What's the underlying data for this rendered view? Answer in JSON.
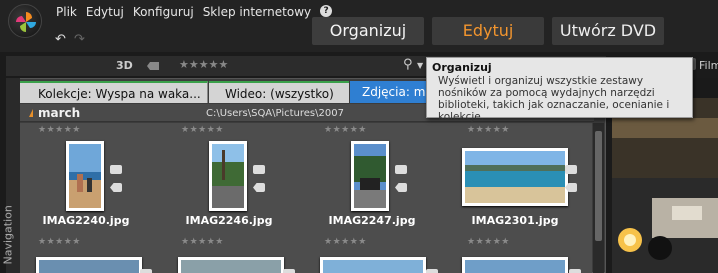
{
  "menu": {
    "file": "Plik",
    "edit": "Edytuj",
    "configure": "Konfiguruj",
    "store": "Sklep internetowy",
    "help": "?"
  },
  "modes": {
    "organize": "Organizuj",
    "edit": "Edytuj",
    "dvd": "Utwórz DVD"
  },
  "toolbar": {
    "three_d": "3D",
    "stars": "★★★★★"
  },
  "collection_tabs": {
    "collection": "Kolekcje: Wyspa na waka...",
    "video": "Wideo: (wszystko)",
    "photos": "Zdjęcia: ma"
  },
  "folder": {
    "name": "march",
    "path": "C:\\Users\\SQA\\Pictures\\2007"
  },
  "navigation_label": "Navigation",
  "film_label": "Film",
  "tooltip": {
    "title": "Organizuj",
    "body": "Wyświetl i organizuj wszystkie zestawy nośników za pomocą wydajnych narzędzi biblioteki, takich jak oznaczanie, ocenianie i kolekcje."
  },
  "items": [
    {
      "filename": "IMAG2240.jpg",
      "stars": "★★★★★"
    },
    {
      "filename": "IMAG2246.jpg",
      "stars": "★★★★★"
    },
    {
      "filename": "IMAG2247.jpg",
      "stars": "★★★★★"
    },
    {
      "filename": "IMAG2301.jpg",
      "stars": "★★★★★"
    }
  ],
  "row2_stars": "★★★★★",
  "colors": {
    "accent_orange": "#f2952e",
    "photo_tab_blue": "#2f7fd2",
    "collection_tab_green": "#3aa04a"
  }
}
